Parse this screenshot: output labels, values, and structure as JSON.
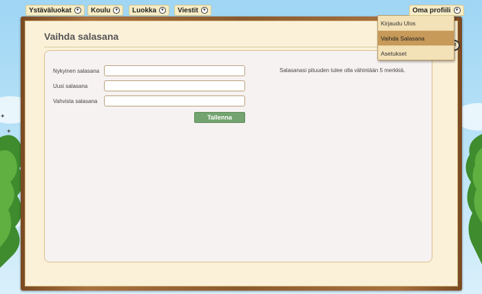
{
  "nav": {
    "items": [
      {
        "label": "Ystäväluokat"
      },
      {
        "label": "Koulu"
      },
      {
        "label": "Luokka"
      },
      {
        "label": "Viestit"
      }
    ],
    "profile_label": "Oma profiili"
  },
  "dropdown": {
    "items": [
      {
        "label": "Kirjaudu Ulos"
      },
      {
        "label": "Vaihda Salasana"
      },
      {
        "label": "Asetukset"
      }
    ],
    "active_index": 1
  },
  "page": {
    "title": "Vaihda salasana",
    "close_label": "×"
  },
  "form": {
    "current_label": "Nykyinen salasana",
    "new_label": "Uusi salasana",
    "confirm_label": "Vahvista salasana",
    "current_value": "",
    "new_value": "",
    "confirm_value": "",
    "save_label": "Tallenna",
    "info": "Salasanasi pituuden tulee olla vähintään 5 merkkiä."
  },
  "colors": {
    "frame": "#8a5a2d",
    "panel": "#f7f2f2",
    "save_button": "#73a46f",
    "dropdown_active": "#c79a5a"
  },
  "icons": {
    "nav_chevron": "chevron-down-circle-icon",
    "close": "close-circle-icon"
  }
}
